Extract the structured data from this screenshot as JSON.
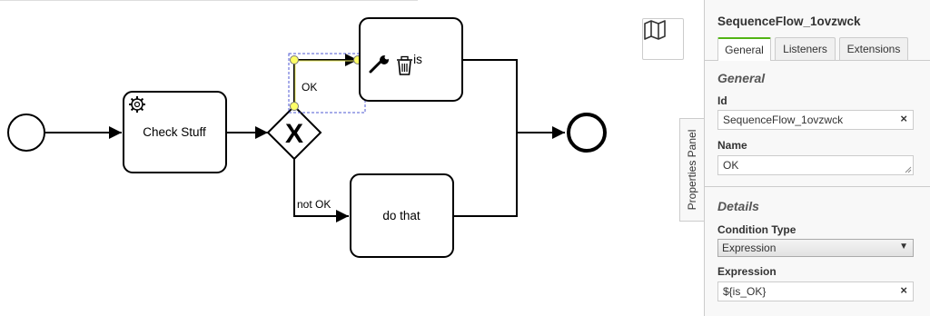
{
  "diagram": {
    "tasks": {
      "check_stuff": "Check Stuff",
      "do_this": "is",
      "do_that": "do that"
    },
    "flows": {
      "ok": "OK",
      "not_ok": "not OK"
    },
    "gateway_glyph": "X"
  },
  "minimap": {
    "icon": "map-icon"
  },
  "properties_tab": {
    "label": "Properties Panel"
  },
  "panel": {
    "title": "SequenceFlow_1ovzwck",
    "tabs": [
      "General",
      "Listeners",
      "Extensions"
    ],
    "general": {
      "heading": "General",
      "id_label": "Id",
      "id_value": "SequenceFlow_1ovzwck",
      "name_label": "Name",
      "name_value": "OK"
    },
    "details": {
      "heading": "Details",
      "condition_type_label": "Condition Type",
      "condition_type_value": "Expression",
      "expression_label": "Expression",
      "expression_value": "${is_OK}"
    },
    "clear_glyph": "×",
    "dropdown_glyph": "▼"
  },
  "colors": {
    "accent": "#52b415",
    "selection": "#4f59d3",
    "handle": "#ffff66"
  }
}
